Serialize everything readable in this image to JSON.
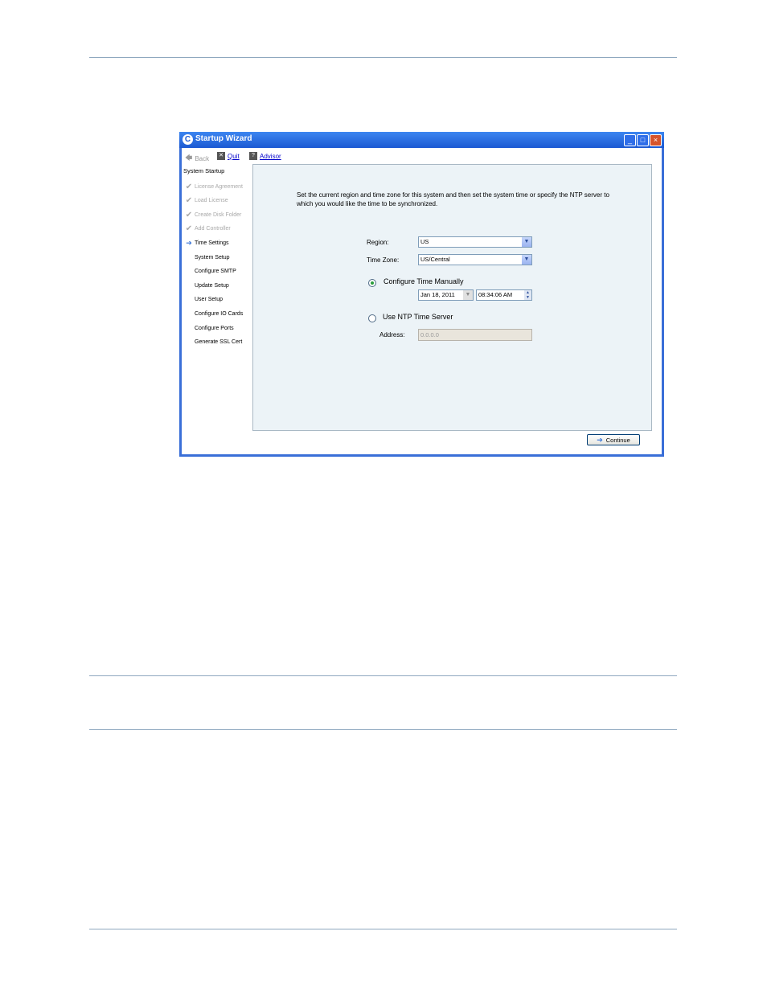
{
  "window": {
    "title": "Startup Wizard",
    "app_icon": "startup-wizard-app-icon",
    "controls": {
      "minimize": "_",
      "maximize": "□",
      "close": "×"
    }
  },
  "toolbar": {
    "back_label": "Back",
    "quit_label": "Quit",
    "advisor_label": "Advisor"
  },
  "sidebar": {
    "header": "System Startup",
    "items": [
      {
        "label": "License Agreement",
        "state": "done"
      },
      {
        "label": "Load License",
        "state": "done"
      },
      {
        "label": "Create Disk Folder",
        "state": "done"
      },
      {
        "label": "Add Controller",
        "state": "done"
      },
      {
        "label": "Time Settings",
        "state": "current"
      },
      {
        "label": "System Setup",
        "state": "todo"
      },
      {
        "label": "Configure SMTP",
        "state": "todo"
      },
      {
        "label": "Update Setup",
        "state": "todo"
      },
      {
        "label": "User Setup",
        "state": "todo"
      },
      {
        "label": "Configure IO Cards",
        "state": "todo"
      },
      {
        "label": "Configure Ports",
        "state": "todo"
      },
      {
        "label": "Generate SSL Cert",
        "state": "todo"
      }
    ]
  },
  "main": {
    "description": "Set the current region and time zone for this system and then set the system time or specify the NTP server to which you would like the time to be synchronized.",
    "region_label": "Region:",
    "region_value": "US",
    "timezone_label": "Time Zone:",
    "timezone_value": "US/Central",
    "manual_label": "Configure Time Manually",
    "manual_selected": true,
    "date_value": "Jan 18, 2011",
    "time_value": "08:34:06 AM",
    "ntp_label": "Use NTP Time Server",
    "ntp_selected": false,
    "address_label": "Address:",
    "address_value": "0.0.0.0"
  },
  "footer": {
    "continue_label": "Continue"
  },
  "colors": {
    "titlebar": "#1b59d3",
    "panel": "#ecf3f7",
    "link": "#0000cc",
    "rule": "#8fa8bf"
  }
}
